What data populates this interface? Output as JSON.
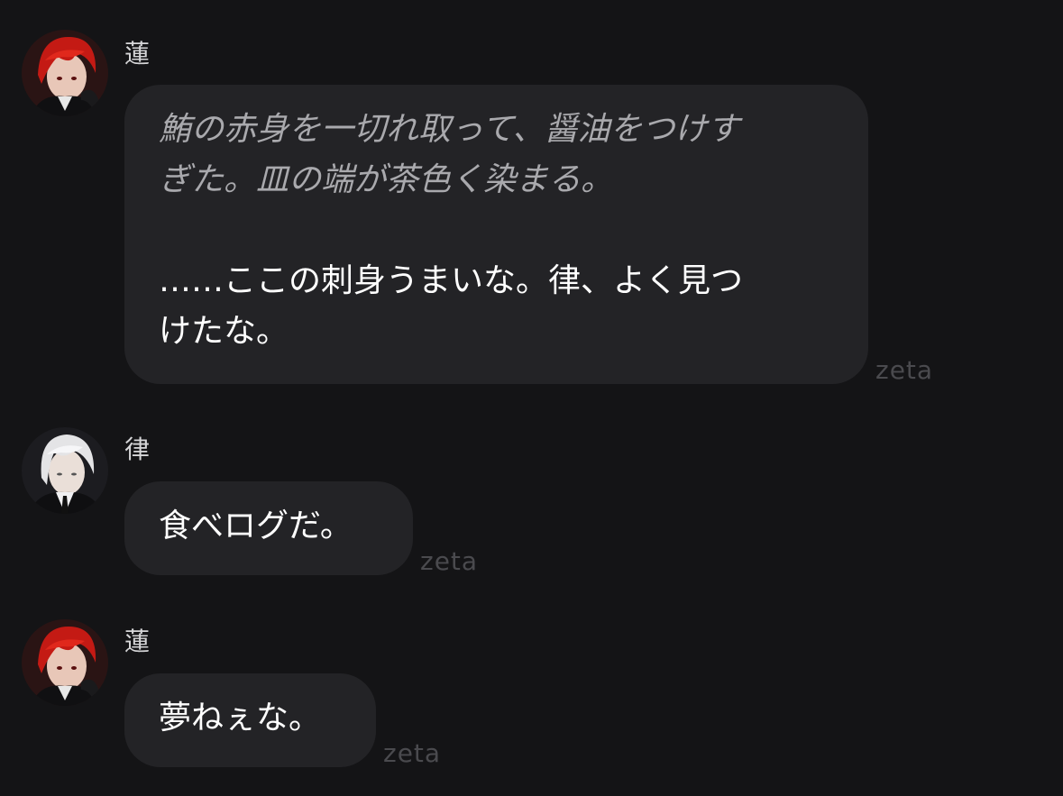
{
  "messages": [
    {
      "sender": "蓮",
      "narration_line1": "鮪の赤身を一切れ取って、醤油をつけす",
      "narration_line2": "ぎた。皿の端が茶色く染まる。",
      "speech_line1": "……ここの刺身うまいな。律、よく見つ",
      "speech_line2": "けたな。",
      "watermark": "zeta"
    },
    {
      "sender": "律",
      "speech_line1": "食べログだ。",
      "watermark": "zeta"
    },
    {
      "sender": "蓮",
      "speech_line1": "夢ねぇな。",
      "watermark": "zeta"
    }
  ],
  "colors": {
    "background": "#141416",
    "bubble": "#232326",
    "narration": "#a9a9ad",
    "speech": "#ffffff",
    "watermark": "#4a4a4e"
  }
}
